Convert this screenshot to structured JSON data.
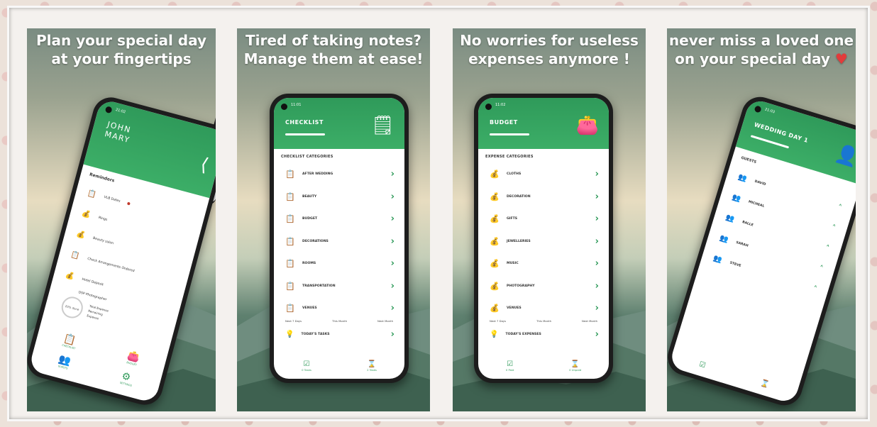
{
  "panels": [
    {
      "caption_l1": "Plan your special day",
      "caption_l2": "at your fingertips"
    },
    {
      "caption_l1": "Tired of taking notes?",
      "caption_l2": "Manage them at ease!"
    },
    {
      "caption_l1": "No worries for useless",
      "caption_l2": "expenses anymore !"
    },
    {
      "caption_l1": "never miss a loved one",
      "caption_l2": "on your special day"
    }
  ],
  "home": {
    "time": "21:02",
    "name1": "JOHN",
    "name2": "MARY",
    "reminders_title": "Reminders",
    "reminders": [
      {
        "label": "VLB Dates"
      },
      {
        "label": "Rings"
      },
      {
        "label": "Beauty salon"
      },
      {
        "label": "Check Arrangements Ordered"
      },
      {
        "label": "Hotel Deposit"
      }
    ],
    "photographer": "DSP Photographer",
    "progress_label": "20% done",
    "total_expense": "Total Expense",
    "remaining": "Remaining",
    "expense": "Expense",
    "nav": [
      "CHECKLIST",
      "BUDGET",
      "GUESTS",
      "SETTINGS"
    ]
  },
  "checklist": {
    "time": "11:01",
    "title": "CHECKLIST",
    "categories_label": "CHECKLIST CATEGORIES",
    "items": [
      "AFTER WEDDING",
      "BEAUTY",
      "BUDGET",
      "DECORATIONS",
      "ROOMS",
      "TRANSPORTATION",
      "VENUES"
    ],
    "filters": [
      "Next 7 Days",
      "This Month",
      "Next Month"
    ],
    "today": "TODAY'S TASKS",
    "bottom": [
      "0 Tasks",
      "2 Tasks"
    ]
  },
  "budget": {
    "time": "11:02",
    "title": "BUDGET",
    "categories_label": "EXPENSE CATEGORIES",
    "items": [
      "CLOTHS",
      "DECORATION",
      "GIFTS",
      "JEWELLERIES",
      "MUSIC",
      "PHOTOGRAPHY",
      "VENUES"
    ],
    "filters": [
      "Next 7 Days",
      "This Month",
      "Next Month"
    ],
    "today": "TODAY'S EXPENSES",
    "bottom": [
      "0 Paid",
      "0 Unpaid"
    ]
  },
  "guests": {
    "time": "21:03",
    "title": "WEDDING DAY 1",
    "guests_label": "GUESTS",
    "items": [
      "DAVID",
      "MICHEAL",
      "BALLE",
      "SARAH",
      "STEVE"
    ]
  }
}
